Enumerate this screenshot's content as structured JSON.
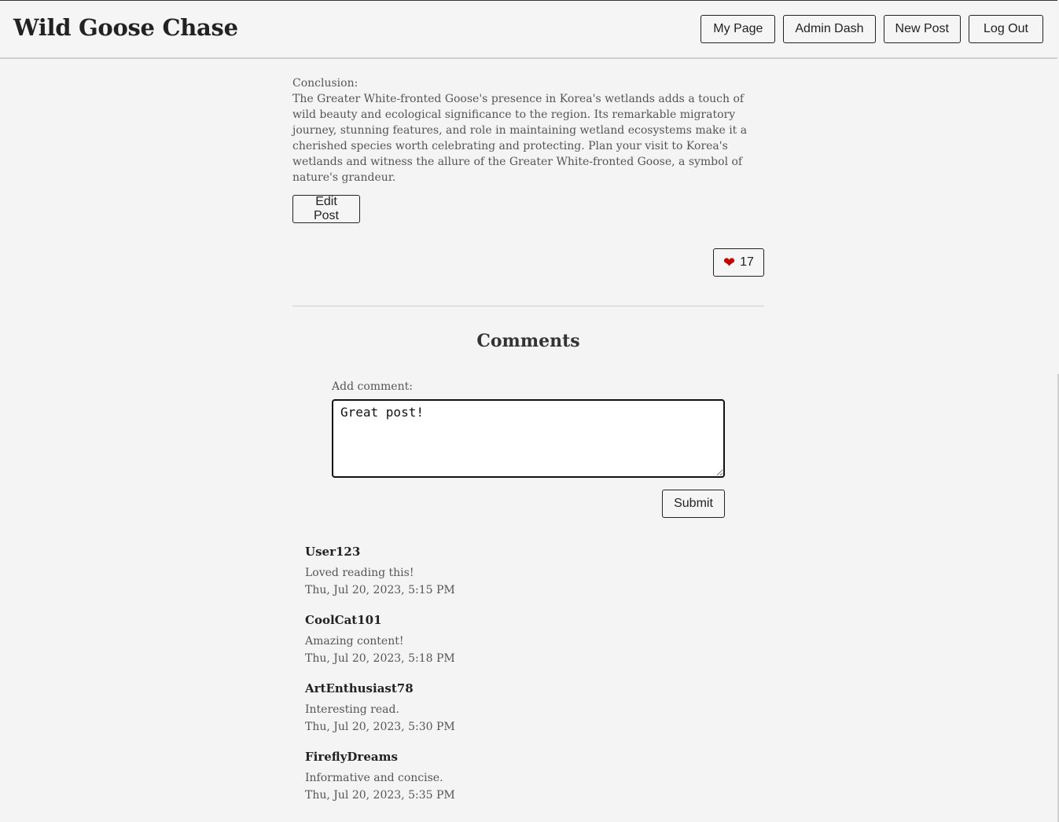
{
  "header": {
    "brand": "Wild Goose Chase",
    "nav": {
      "my_page": "My Page",
      "admin_dash": "Admin Dash",
      "new_post": "New Post",
      "log_out": "Log Out"
    }
  },
  "post": {
    "conclusion_heading": "Conclusion:",
    "conclusion_text": "The Greater White-fronted Goose's presence in Korea's wetlands adds a touch of wild beauty and ecological significance to the region. Its remarkable migratory journey, stunning features, and role in maintaining wetland ecosystems make it a cherished species worth celebrating and protecting. Plan your visit to Korea's wetlands and witness the allure of the Greater White-fronted Goose, a symbol of nature's grandeur.",
    "edit_label": "Edit Post",
    "like_count": "17"
  },
  "comments": {
    "title": "Comments",
    "add_label": "Add comment:",
    "input_value": "Great post!",
    "submit_label": "Submit",
    "items": [
      {
        "author": "User123",
        "text": "Loved reading this!",
        "date": "Thu, Jul 20, 2023, 5:15 PM"
      },
      {
        "author": "CoolCat101",
        "text": "Amazing content!",
        "date": "Thu, Jul 20, 2023, 5:18 PM"
      },
      {
        "author": "ArtEnthusiast78",
        "text": "Interesting read.",
        "date": "Thu, Jul 20, 2023, 5:30 PM"
      },
      {
        "author": "FireflyDreams",
        "text": "Informative and concise.",
        "date": "Thu, Jul 20, 2023, 5:35 PM"
      }
    ]
  },
  "colors": {
    "heart": "#c40000",
    "background": "#f4f4f4"
  }
}
